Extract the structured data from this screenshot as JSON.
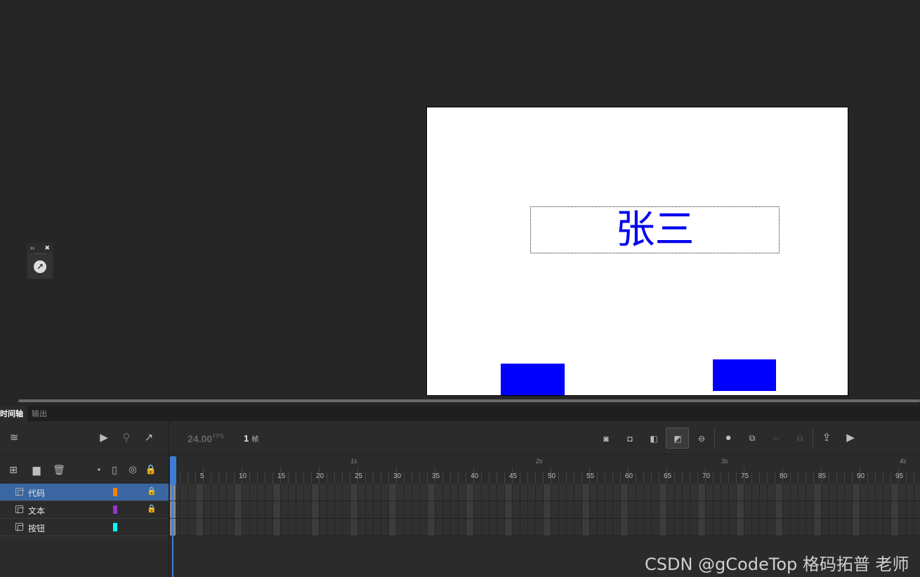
{
  "stage": {
    "text": "张三"
  },
  "panel_tabs": [
    {
      "label": "时间轴",
      "active": true
    },
    {
      "label": "输出",
      "active": false
    }
  ],
  "timeline": {
    "fps_value": "24.00",
    "fps_unit": "FPS",
    "current_frame": "1",
    "frame_unit": "帧"
  },
  "layers": [
    {
      "name": "代码",
      "color": "#ff7f00",
      "locked": true,
      "selected": true
    },
    {
      "name": "文本",
      "color": "#9933cc",
      "locked": true,
      "selected": false
    },
    {
      "name": "按钮",
      "color": "#00ffff",
      "locked": false,
      "selected": false
    }
  ],
  "ruler": {
    "frame_ticks": [
      "5",
      "10",
      "15",
      "20",
      "25",
      "30",
      "35",
      "40",
      "45",
      "50",
      "55",
      "60",
      "65",
      "70",
      "75",
      "80",
      "85",
      "90",
      "95"
    ],
    "second_marks": [
      "1s",
      "2s",
      "3s",
      "4s"
    ]
  },
  "icons": {
    "toolbar_left": [
      "layers-icon",
      "camera-icon",
      "hierarchy-icon",
      "graph-icon"
    ],
    "layer_header": [
      "add-layer-icon",
      "add-folder-icon",
      "delete-icon",
      "dot-icon",
      "outline-icon",
      "eye-hidden-icon",
      "lock-icon"
    ],
    "toolbar_right": [
      "keyframe-icon",
      "blank-keyframe-icon",
      "frame-icon",
      "auto-keyframe-icon",
      "remove-icon",
      "onion-skin-icon",
      "edit-multiple-icon",
      "loop-icon",
      "sync-icon",
      "export-icon",
      "play-icon"
    ]
  },
  "watermark": "CSDN @gCodeTop  格码拓普 老师"
}
